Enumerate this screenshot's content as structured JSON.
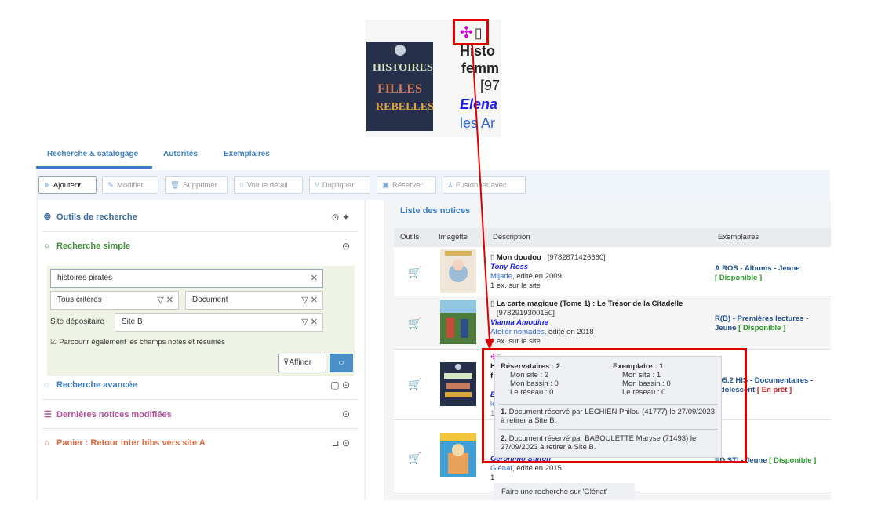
{
  "zoom": {
    "cover_lines": [
      "HISTOIRES",
      "FILLES",
      "REBELLES"
    ],
    "title_line1": "Histo",
    "title_line2": "femm",
    "isbn_partial": "[97",
    "author_partial": "Elena",
    "publisher_partial": "les Ar"
  },
  "tabs": [
    {
      "label": "Recherche & catalogage"
    },
    {
      "label": "Autorités"
    },
    {
      "label": "Exemplaires"
    }
  ],
  "toolbar": {
    "add": "Ajouter",
    "edit": "Modifier",
    "delete": "Supprimer",
    "detail": "Voir le détail",
    "duplicate": "Dupliquer",
    "reserve": "Réserver",
    "merge": "Fusionner avec"
  },
  "left": {
    "outils": "Outils de recherche",
    "simple": "Recherche simple",
    "query": "histoires pirates",
    "criteria": "Tous critères",
    "doctype": "Document",
    "site_label": "Site dépositaire",
    "site_value": "Site B",
    "notes_checkbox": "Parcourir également les champs notes et résumés",
    "refine": "Affiner",
    "advanced": "Recherche avancée",
    "recent": "Dernières notices modifiées",
    "basket": "Panier : Retour inter bibs vers site A"
  },
  "list": {
    "title": "Liste des notices",
    "columns": [
      "Outils",
      "Imagette",
      "Description",
      "Exemplaires"
    ],
    "rows": [
      {
        "title": "Mon doudou",
        "isbn": "[9782871426660]",
        "author": "Tony Ross",
        "publisher": "Mijade",
        "edition": ", édité en 2009",
        "copies": "1 ex. sur le site",
        "location": "A ROS - Albums - Jeune",
        "status": "[ Disponible ]"
      },
      {
        "title": "La carte magique (Tome 1) : Le Trésor de la Citadelle",
        "isbn": "[9782919300150]",
        "author": "Vianna Amodine",
        "publisher": "Atelier nomades",
        "edition": ", édité en 2018",
        "copies": "1 ex. sur le site",
        "location": "R(B) - Premières lectures -",
        "location2": "Jeune",
        "status": "[ Disponible ]"
      },
      {
        "title_partial": "H",
        "title_partial2": "f",
        "author_partial": "E",
        "publisher_partial": "le",
        "copies_partial": "1",
        "location": "305.2 HIS - Documentaires -",
        "location2": "Adolescent",
        "status": "[ En prêt ]"
      },
      {
        "author": "Geronimo Stilton",
        "publisher": "Glénat",
        "edition": ", édité en 2015",
        "copies_partial": "1",
        "location": "ED STI - Jeune",
        "status": "[ Disponible ]"
      }
    ]
  },
  "tooltip": {
    "res_title": "Réservataires : 2",
    "res_site": "Mon site : 2",
    "res_bassin": "Mon bassin : 0",
    "res_reseau": "Le réseau : 0",
    "ex_title": "Exemplaire : 1",
    "ex_site": "Mon site : 1",
    "ex_bassin": "Mon bassin : 0",
    "ex_reseau": "Le réseau : 0",
    "res1_num": "1.",
    "res1": "Document réservé par LECHIEN Philou (41777) le 27/09/2023 à retirer à Site B.",
    "res2_num": "2.",
    "res2": "Document réservé par BABOULETTE Maryse (71493) le 27/09/2023 à retirer à Site B."
  },
  "context_menu": {
    "item": "Faire une recherche sur 'Glénat'"
  },
  "colors": {
    "accent": "#3a7fc4",
    "highlight_box": "#e00000",
    "available": "#2c9a2c",
    "on_loan": "#d02020"
  }
}
